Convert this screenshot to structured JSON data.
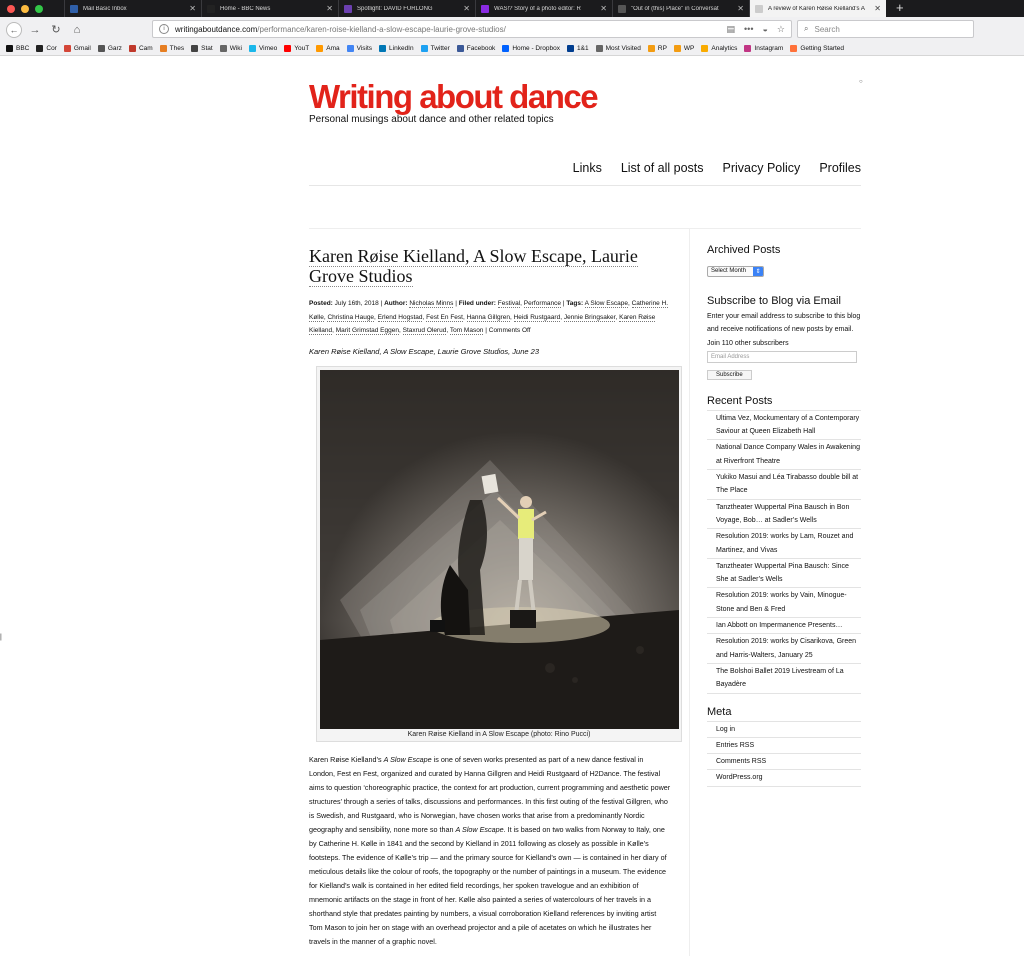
{
  "browser": {
    "tabs": [
      {
        "title": "Mail Basic Inbox",
        "color": "#2f5fa8",
        "active": false
      },
      {
        "title": "Home - BBC News",
        "color": "#222222",
        "active": false
      },
      {
        "title": "Spotlight: DAVID FURLONG",
        "color": "#6b3fb0",
        "active": false
      },
      {
        "title": "WAS!? Story of a photo editor: R",
        "color": "#8a2be2",
        "active": false
      },
      {
        "title": "\"Out of (this) Place\" in Conversat",
        "color": "#555555",
        "active": false
      },
      {
        "title": "A review of Karen Røise Kielland's A",
        "color": "#cccccc",
        "active": true
      }
    ],
    "url_domain": "writingaboutdance.com",
    "url_path": "/performance/karen-roise-kielland-a-slow-escape-laurie-grove-studios/",
    "search_placeholder": "Search",
    "bookmarks": [
      {
        "label": "BBC",
        "color": "#111111"
      },
      {
        "label": "Cor",
        "color": "#222222"
      },
      {
        "label": "Gmail",
        "color": "#d44638"
      },
      {
        "label": "Garz",
        "color": "#555555"
      },
      {
        "label": "Cam",
        "color": "#c0392b"
      },
      {
        "label": "Thes",
        "color": "#e67e22"
      },
      {
        "label": "Stat",
        "color": "#444444"
      },
      {
        "label": "Wiki",
        "color": "#666666"
      },
      {
        "label": "Vimeo",
        "color": "#1ab7ea"
      },
      {
        "label": "YouT",
        "color": "#ff0000"
      },
      {
        "label": "Ama",
        "color": "#ff9900"
      },
      {
        "label": "Visits",
        "color": "#4285f4"
      },
      {
        "label": "LinkedIn",
        "color": "#0077b5"
      },
      {
        "label": "Twitter",
        "color": "#1da1f2"
      },
      {
        "label": "Facebook",
        "color": "#3b5998"
      },
      {
        "label": "Home - Dropbox",
        "color": "#0061ff"
      },
      {
        "label": "1&1",
        "color": "#003d8f"
      },
      {
        "label": "Most Visited",
        "color": "#666666"
      },
      {
        "label": "RP",
        "color": "#f39c12"
      },
      {
        "label": "WP",
        "color": "#f39c12"
      },
      {
        "label": "Analytics",
        "color": "#f9ab00"
      },
      {
        "label": "Instagram",
        "color": "#c13584"
      },
      {
        "label": "Getting Started",
        "color": "#ff7139"
      }
    ]
  },
  "site": {
    "title": "Writing about dance",
    "description": "Personal musings about dance and other related topics",
    "nav": [
      "Links",
      "List of all posts",
      "Privacy Policy",
      "Profiles"
    ]
  },
  "post": {
    "title": "Karen Røise Kielland, A Slow Escape, Laurie Grove Studios",
    "meta": {
      "posted_label": "Posted:",
      "date": "July 16th, 2018",
      "author_label": "Author:",
      "author": "Nicholas Minns",
      "filed_label": "Filed under:",
      "categories": [
        "Festival",
        "Performance"
      ],
      "tags_label": "Tags:",
      "tags": [
        "A Slow Escape",
        "Catherine H. Kølle",
        "Christina Hauge",
        "Erlend Hogstad",
        "Fest En Fest",
        "Hanna Gillgren",
        "Heidi Rustgaard",
        "Jennie Bringsaker",
        "Karen Røise Kielland",
        "Marit Grimstad Eggen",
        "Staxrud Olerud",
        "Tom Mason"
      ],
      "comments": "Comments Off"
    },
    "subtitle": "Karen Røise Kielland, A Slow Escape, Laurie Grove Studios, June 23",
    "caption": "Karen Røise Kielland in A Slow Escape (photo: Rino Pucci)",
    "body": [
      {
        "t": "Karen Røise Kielland’s ",
        "i": false
      },
      {
        "t": "A Slow Escape",
        "i": true
      },
      {
        "t": " is one of seven works presented as part of a new dance festival in London, Fest en Fest, organized and curated by Hanna Gillgren and Heidi Rustgaard of H2Dance. The festival aims to question ‘choreographic practice, the context for art production, current programming and aesthetic power structures’ through a series of talks, discussions and performances. In this first outing of the festival Gillgren, who is Swedish, and Rustgaard, who is Norwegian, have chosen works that arise from a predominantly Nordic geography and sensibility, none more so than ",
        "i": false
      },
      {
        "t": "A Slow Escape",
        "i": true
      },
      {
        "t": ". It is based on two walks from Norway to Italy, one by Catherine H. Kølle in 1841 and the second by Kielland in 2011 following as closely as possible in Kølle’s footsteps. The evidence of Kølle’s trip — and the primary source for Kielland’s own — is contained in her diary of meticulous details like the colour of roofs, the topography or the number of paintings in a museum. The evidence for Kielland’s walk is contained in her edited field recordings, her spoken travelogue and an exhibition of mnemonic artifacts on the stage in front of her. Kølle also painted a series of watercolours of her travels in a shorthand style that predates painting by numbers, a visual corroboration Kielland references by inviting artist Tom Mason to join her on stage with an overhead projector and a pile of acetates on which he illustrates her travels in the manner of a graphic novel.",
        "i": false
      }
    ]
  },
  "sidebar": {
    "archived_title": "Archived Posts",
    "archived_select": "Select Month",
    "subscribe_title": "Subscribe to Blog via Email",
    "subscribe_text": "Enter your email address to subscribe to this blog and receive notifications of new posts by email.",
    "subscribers": "Join 110 other subscribers",
    "email_placeholder": "Email Address",
    "subscribe_button": "Subscribe",
    "recent_title": "Recent Posts",
    "recent": [
      "Ultima Vez, Mockumentary of a Contemporary Saviour at Queen Elizabeth Hall",
      "National Dance Company Wales in Awakening at Riverfront Theatre",
      "Yukiko Masui and Léa Tirabasso double bill at The Place",
      "Tanztheater Wuppertal Pina Bausch in Bon Voyage, Bob… at Sadler’s Wells",
      "Resolution 2019: works by Lam, Rouzet and Martinez, and Vivas",
      "Tanztheater Wuppertal Pina Bausch: Since She at Sadler’s Wells",
      "Resolution 2019: works by Vain, Minogue-Stone and Ben & Fred",
      "Ian Abbott on Impermanence Presents…",
      "Resolution 2019: works by Cisarikova, Green and Harris-Walters, January 25",
      "The Bolshoi Ballet 2019 Livestream of La Bayadère"
    ],
    "meta_title": "Meta",
    "meta_links": [
      "Log in",
      "Entries RSS",
      "Comments RSS",
      "WordPress.org"
    ]
  }
}
